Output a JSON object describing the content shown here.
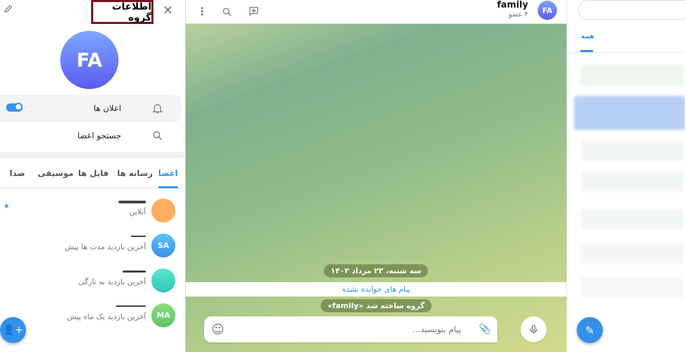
{
  "info_panel": {
    "title": "اطلاعات گروه",
    "avatar_initials": "FA",
    "notifications_label": "اعلان ها",
    "notifications_on": true,
    "search_members_label": "جستجو اعضا",
    "tabs": [
      {
        "label": "اعضا",
        "active": true
      },
      {
        "label": "رسانه ها"
      },
      {
        "label": "فایل ها"
      },
      {
        "label": "موسیقی"
      },
      {
        "label": "صدا"
      }
    ],
    "members": [
      {
        "initials": "",
        "status": "آنلاین",
        "color": "#ffa95e",
        "admin": true
      },
      {
        "initials": "SA",
        "status": "آخرین بازدید مدت ها پیش",
        "color": "#3a9bea"
      },
      {
        "initials": "",
        "status": "آخرین بازدید به تازگی",
        "color": "#3dd2c0"
      },
      {
        "initials": "MA",
        "status": "آخرین بازدید یک ماه پیش",
        "color": "#6ccf72"
      }
    ]
  },
  "chat": {
    "name": "family",
    "members_count": "۴ عضو",
    "avatar_initials": "FA",
    "date_label": "سه شنبه، ۲۳ مرداد ۱۴۰۳",
    "unread_label": "پیام های خوانده نشده",
    "service_message": "گروه ساخته شد «family»",
    "composer_placeholder": "پیام بنویسید..."
  },
  "chat_list": {
    "tab_all": "همه"
  },
  "colors": {
    "accent": "#3390ec"
  }
}
